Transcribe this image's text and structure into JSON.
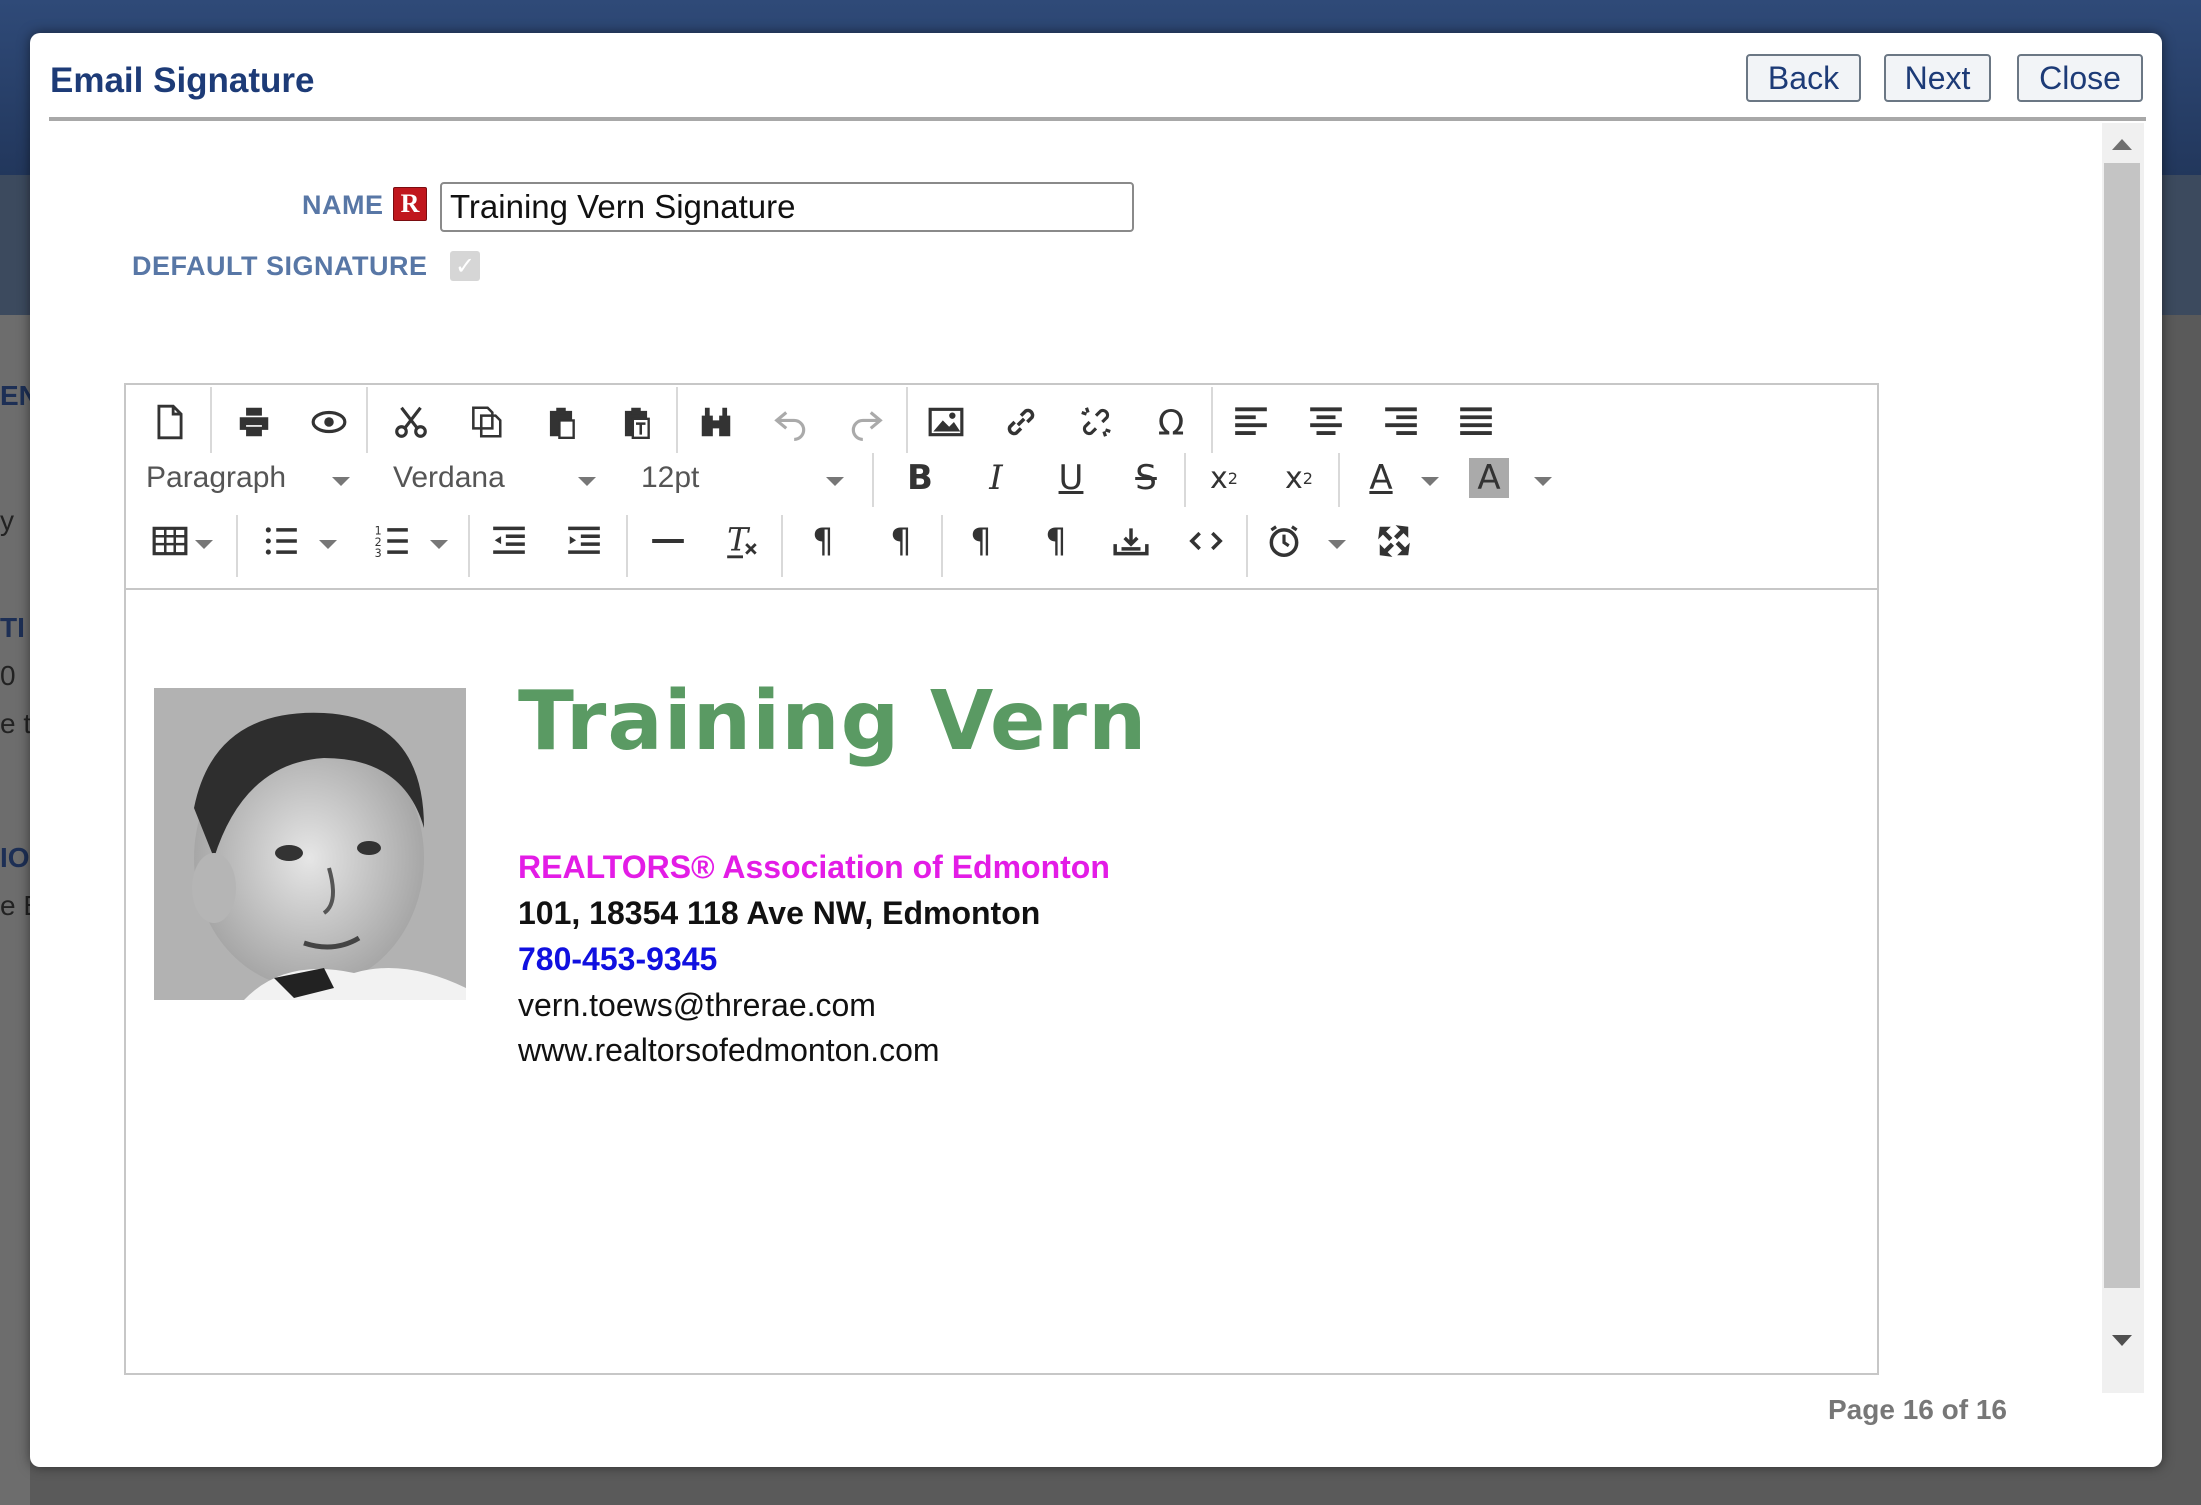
{
  "background": {
    "fragments": [
      "ENT",
      "y",
      "TI",
      "0",
      "e t",
      "IO",
      "e B"
    ]
  },
  "dialog": {
    "title": "Email Signature",
    "buttons": {
      "back": "Back",
      "next": "Next",
      "close": "Close"
    },
    "page_indicator": "Page 16 of 16"
  },
  "form": {
    "name_label": "NAME",
    "required_badge": "R",
    "name_value": "Training Vern Signature",
    "default_label": "DEFAULT SIGNATURE",
    "default_checked": true
  },
  "toolbar": {
    "format": "Paragraph",
    "font": "Verdana",
    "size": "12pt",
    "row1_icons": [
      "new-document-icon",
      "print-icon",
      "preview-icon",
      "cut-icon",
      "copy-icon",
      "paste-icon",
      "paste-text-icon",
      "find-icon",
      "undo-icon",
      "redo-icon",
      "image-icon",
      "link-icon",
      "unlink-icon",
      "special-char-icon",
      "align-left-icon",
      "align-center-icon",
      "align-right-icon",
      "align-justify-icon"
    ],
    "row2_icons": [
      "bold-icon",
      "italic-icon",
      "underline-icon",
      "strikethrough-icon",
      "subscript-icon",
      "superscript-icon",
      "text-color-icon",
      "background-color-icon"
    ],
    "row3_icons": [
      "table-icon",
      "bullet-list-icon",
      "numbered-list-icon",
      "outdent-icon",
      "indent-icon",
      "horizontal-rule-icon",
      "clear-format-icon",
      "ltr-icon",
      "rtl-icon",
      "paragraph-icon",
      "paragraph-alt-icon",
      "insert-icon",
      "source-code-icon",
      "datetime-icon",
      "fullscreen-icon"
    ]
  },
  "signature": {
    "name": "Training Vern",
    "association": "REALTORS® Association of Edmonton",
    "address": "101, 18354 118 Ave NW, Edmonton",
    "phone": "780-453-9345",
    "email": "vern.toews@threrae.com",
    "website": "www.realtorsofedmonton.com",
    "colors": {
      "name": "#5a9a63",
      "association": "#e31ce6",
      "phone": "#1010e0"
    }
  }
}
